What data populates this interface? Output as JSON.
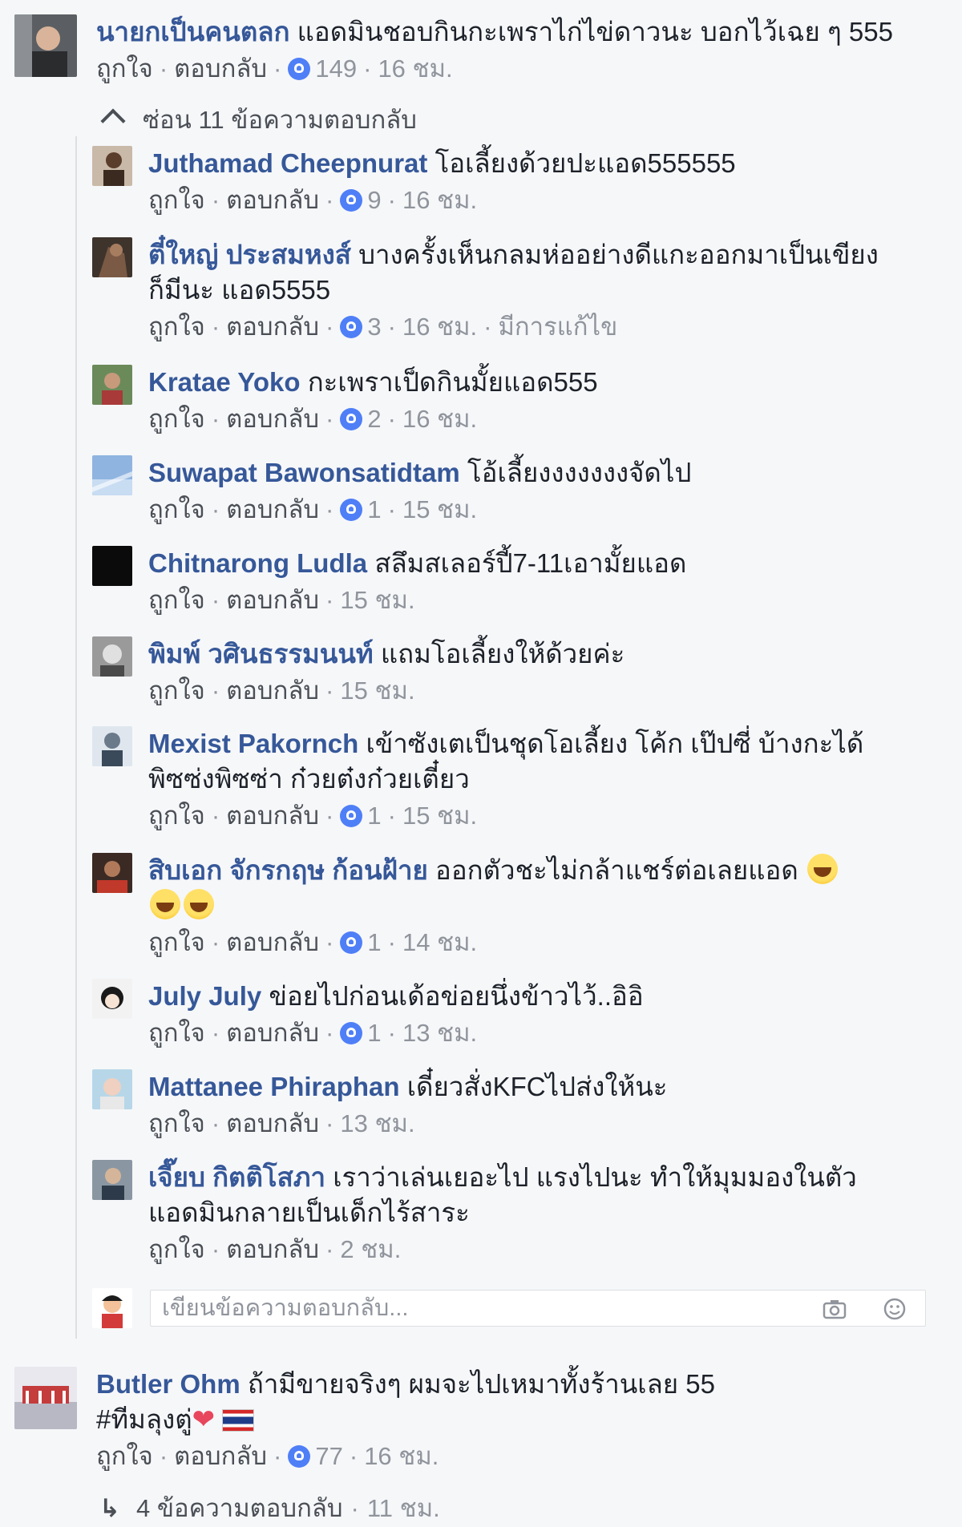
{
  "labels": {
    "like": "ถูกใจ",
    "reply": "ตอบกลับ",
    "edited": "มีการแก้ไข",
    "hide_replies": "ซ่อน 11 ข้อความตอบกลับ",
    "composer_placeholder": "เขียนข้อความตอบกลับ...",
    "more_replies": "4 ข้อความตอบกลับ",
    "more_replies_time": "11 ชม."
  },
  "colors": {
    "author_link": "#365899",
    "meta_gray": "#90949c",
    "like_badge_blue": "#4f7ff7"
  },
  "top_comment": {
    "author": "นายกเป็นคนตลก",
    "text": "แอดมินชอบกินกะเพราไก่ไข่ดาวนะ บอกไว้เฉย ๆ 555",
    "likes": "149",
    "time": "16 ชม."
  },
  "replies": [
    {
      "author": "Juthamad Cheepnurat",
      "text": "โอเลี้ยงด้วยปะแอด555555",
      "likes": "9",
      "time": "16 ชม."
    },
    {
      "author": "ตี๋ใหญ่ ประสมหงส์",
      "text": "บางครั้งเห็นกลมห่ออย่างดีแกะออกมาเป็นเขียง",
      "text2": "ก็มีนะ แอด5555",
      "likes": "3",
      "time": "16 ชม.",
      "edited": true
    },
    {
      "author": "Kratae Yoko",
      "text": "กะเพราเป็ดกินมั้ยแอด555",
      "likes": "2",
      "time": "16 ชม."
    },
    {
      "author": "Suwapat Bawonsatidtam",
      "text": "โอ้เลี้ยงงงงงงงจัดไป",
      "likes": "1",
      "time": "15 ชม."
    },
    {
      "author": "Chitnarong Ludla",
      "text": "สลึมสเลอร์ปี้7-11เอามั้ยแอด",
      "likes": "",
      "time": "15 ชม."
    },
    {
      "author": "พิมพ์ วศินธรรมนนท์",
      "text": "แถมโอเลี้ยงให้ด้วยค่ะ",
      "likes": "",
      "time": "15 ชม."
    },
    {
      "author": "Mexist Pakornch",
      "text": "เข้าซังเตเป็นชุดโอเลี้ยง โค้ก เป๊ปซี่ บ้างกะได้",
      "text2": "พิซซ่งพิซซ่า ก๋วยต๋งก๋วยเตี๋ยว",
      "likes": "1",
      "time": "15 ชม."
    },
    {
      "author": "สิบเอก จักรกฤษ ก้อนฝ้าย",
      "text": "ออกตัวชะไม่กล้าแชร์ต่อเลยแอด",
      "likes": "1",
      "time": "14 ชม."
    },
    {
      "author": "July July",
      "text": "ข่อยไปก่อนเด้อข่อยนึ่งข้าวไว้..อิอิ",
      "likes": "1",
      "time": "13 ชม."
    },
    {
      "author": "Mattanee Phiraphan",
      "text": "เดี๋ยวสั่งKFCไปส่งให้นะ",
      "likes": "",
      "time": "13 ชม."
    },
    {
      "author": "เจี๊ยบ กิตติโสภา",
      "text": "เราว่าเล่นเยอะไป แรงไปนะ ทำให้มุมมองในตัว",
      "text2": "แอดมินกลายเป็นเด็กไร้สาระ",
      "likes": "",
      "time": "2 ชม."
    }
  ],
  "bottom_comment": {
    "author": "Butler Ohm",
    "text": "ถ้ามีขายจริงๆ ผมจะไปเหมาทั้งร้านเลย 55",
    "text2": "#ทีมลุงตู่",
    "likes": "77",
    "time": "16 ชม."
  }
}
